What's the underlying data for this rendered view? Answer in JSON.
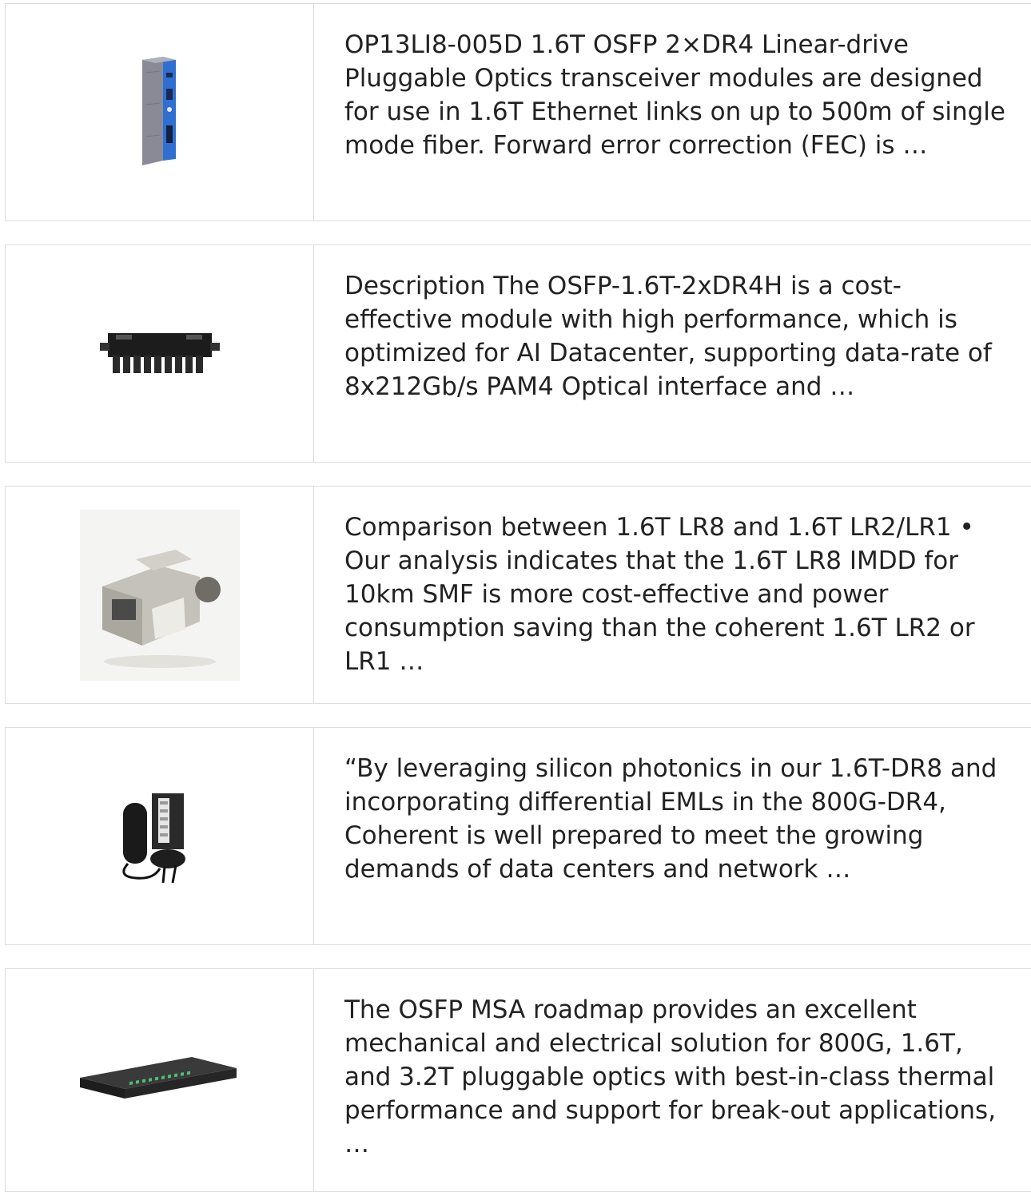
{
  "products": [
    {
      "image_icon": "transceiver-module-photo",
      "text": "OP13LI8-005D 1.6T OSFP 2×DR4 Linear-drive Pluggable Optics transceiver modules are designed for use in 1.6T Ethernet links on up to 500m of single mode fiber. Forward error correction (FEC) is …"
    },
    {
      "image_icon": "fiber-terminal-box-photo",
      "text": "Description The OSFP-1.6T-2xDR4H is a cost-effective module with high performance, which is optimized for AI Datacenter, supporting data-rate of 8x212Gb/s PAM4 Optical interface and …"
    },
    {
      "image_icon": "keystone-jack-photo",
      "text": "Comparison between 1.6T LR8 and 1.6T LR2/LR1 • Our analysis indicates that the 1.6T LR8 IMDD for 10km SMF is more cost-effective and power consumption saving than the coherent 1.6T LR2 or LR1 …"
    },
    {
      "image_icon": "splice-closure-photo",
      "text": "“By leveraging silicon photonics in our 1.6T-DR8 and incorporating differential EMLs in the 800G-DR4, Coherent is well prepared to meet the growing demands of data centers and network …"
    },
    {
      "image_icon": "rack-patch-panel-photo",
      "text": "The OSFP MSA roadmap provides an excellent mechanical and electrical solution for 800G, 1.6T, and 3.2T pluggable optics with best-in-class thermal performance and support for break-out applications, …"
    }
  ]
}
